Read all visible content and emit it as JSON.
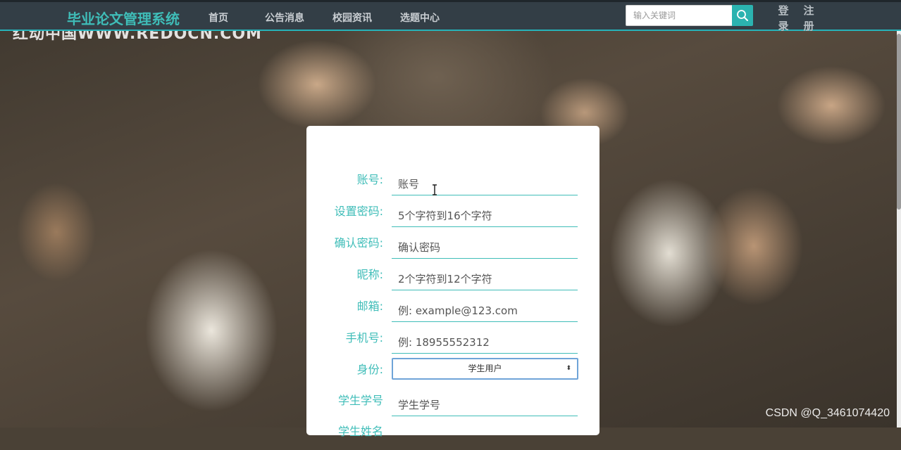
{
  "nav": {
    "brand": "毕业论文管理系统",
    "links": [
      "首页",
      "公告消息",
      "校园资讯",
      "选题中心"
    ],
    "search_placeholder": "输入关键词",
    "login": [
      "登",
      "录"
    ],
    "register": [
      "注",
      "册"
    ]
  },
  "background_watermark": "红动中国WWW.REDOCN.COM",
  "form": {
    "rows": [
      {
        "label": "账号:",
        "placeholder": "账号"
      },
      {
        "label": "设置密码:",
        "placeholder": "5个字符到16个字符"
      },
      {
        "label": "确认密码:",
        "placeholder": "确认密码"
      },
      {
        "label": "昵称:",
        "placeholder": "2个字符到12个字符"
      },
      {
        "label": "邮箱:",
        "placeholder": "例: example@123.com"
      },
      {
        "label": "手机号:",
        "placeholder": "例: 18955552312"
      },
      {
        "label": "身份:",
        "selected": "学生用户"
      },
      {
        "label": "学生学号",
        "placeholder": "学生学号"
      },
      {
        "label": "学生姓名"
      }
    ]
  },
  "csdn_watermark": "CSDN @Q_3461074420",
  "colors": {
    "accent": "#3fbdb8",
    "navbar": "#333e46",
    "select_border": "#6fa4d8"
  },
  "icons": [
    "search-icon",
    "text-cursor-icon",
    "select-arrow-icon"
  ]
}
